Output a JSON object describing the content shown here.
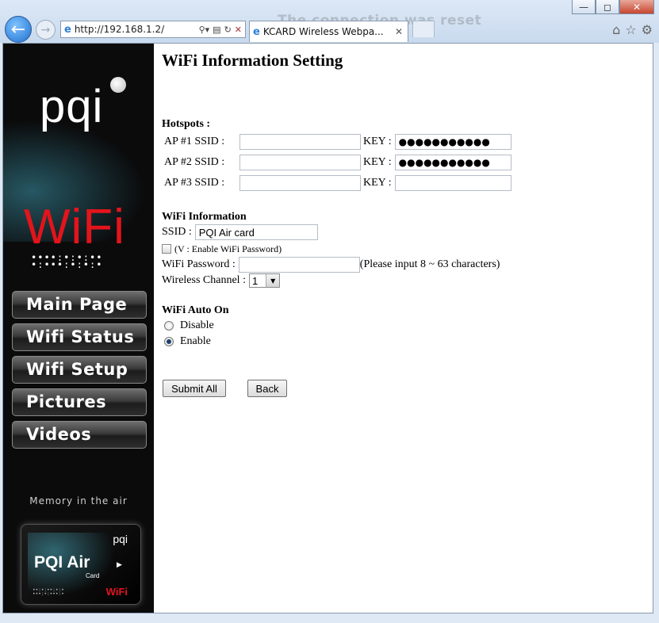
{
  "browser": {
    "address": "http://192.168.1.2/",
    "tab_title": "KCARD Wireless Webpa...",
    "ghost_text": "The connection was reset",
    "window_buttons": [
      "minimize",
      "maximize",
      "close"
    ],
    "icons": [
      "back-arrow-icon",
      "forward-arrow-icon",
      "ie-logo-icon",
      "search-icon",
      "compat-view-icon",
      "refresh-icon",
      "stop-icon",
      "home-icon",
      "favorites-star-icon",
      "tools-gear-icon"
    ]
  },
  "sidebar": {
    "logo": "pqi",
    "wifi_logo": "WiFi",
    "dots": "••••:•:•:••\n•:•••:•:•:•",
    "menu": [
      {
        "label": "Main Page"
      },
      {
        "label": "Wifi Status"
      },
      {
        "label": "Wifi Setup"
      },
      {
        "label": "Pictures"
      },
      {
        "label": "Videos"
      }
    ],
    "tagline": "Memory in the air",
    "card": {
      "brand": "pqi",
      "name": "PQI Air",
      "sub": "Card",
      "wifi": "WiFi"
    }
  },
  "page": {
    "title": "WiFi Information Setting",
    "hotspots": {
      "heading": "Hotspots :",
      "key_label": "KEY :",
      "rows": [
        {
          "label": "AP #1 SSID :",
          "ssid": "",
          "key": "●●●●●●●●●●●"
        },
        {
          "label": "AP #2 SSID :",
          "ssid": "",
          "key": "●●●●●●●●●●●"
        },
        {
          "label": "AP #3 SSID :",
          "ssid": "",
          "key": ""
        }
      ]
    },
    "wifi_info": {
      "heading": "WiFi Information",
      "ssid_label": "SSID :",
      "ssid_value": "PQI Air card",
      "enable_pw_label": "(V : Enable WiFi Password)",
      "password_label": "WiFi Password :",
      "password_value": "",
      "password_hint": "(Please input 8 ~ 63 characters)",
      "channel_label": "Wireless Channel :",
      "channel_value": "1"
    },
    "auto_on": {
      "heading": "WiFi Auto On",
      "options": [
        "Disable",
        "Enable"
      ],
      "selected": "Enable"
    },
    "buttons": {
      "submit": "Submit All",
      "back": "Back"
    }
  }
}
